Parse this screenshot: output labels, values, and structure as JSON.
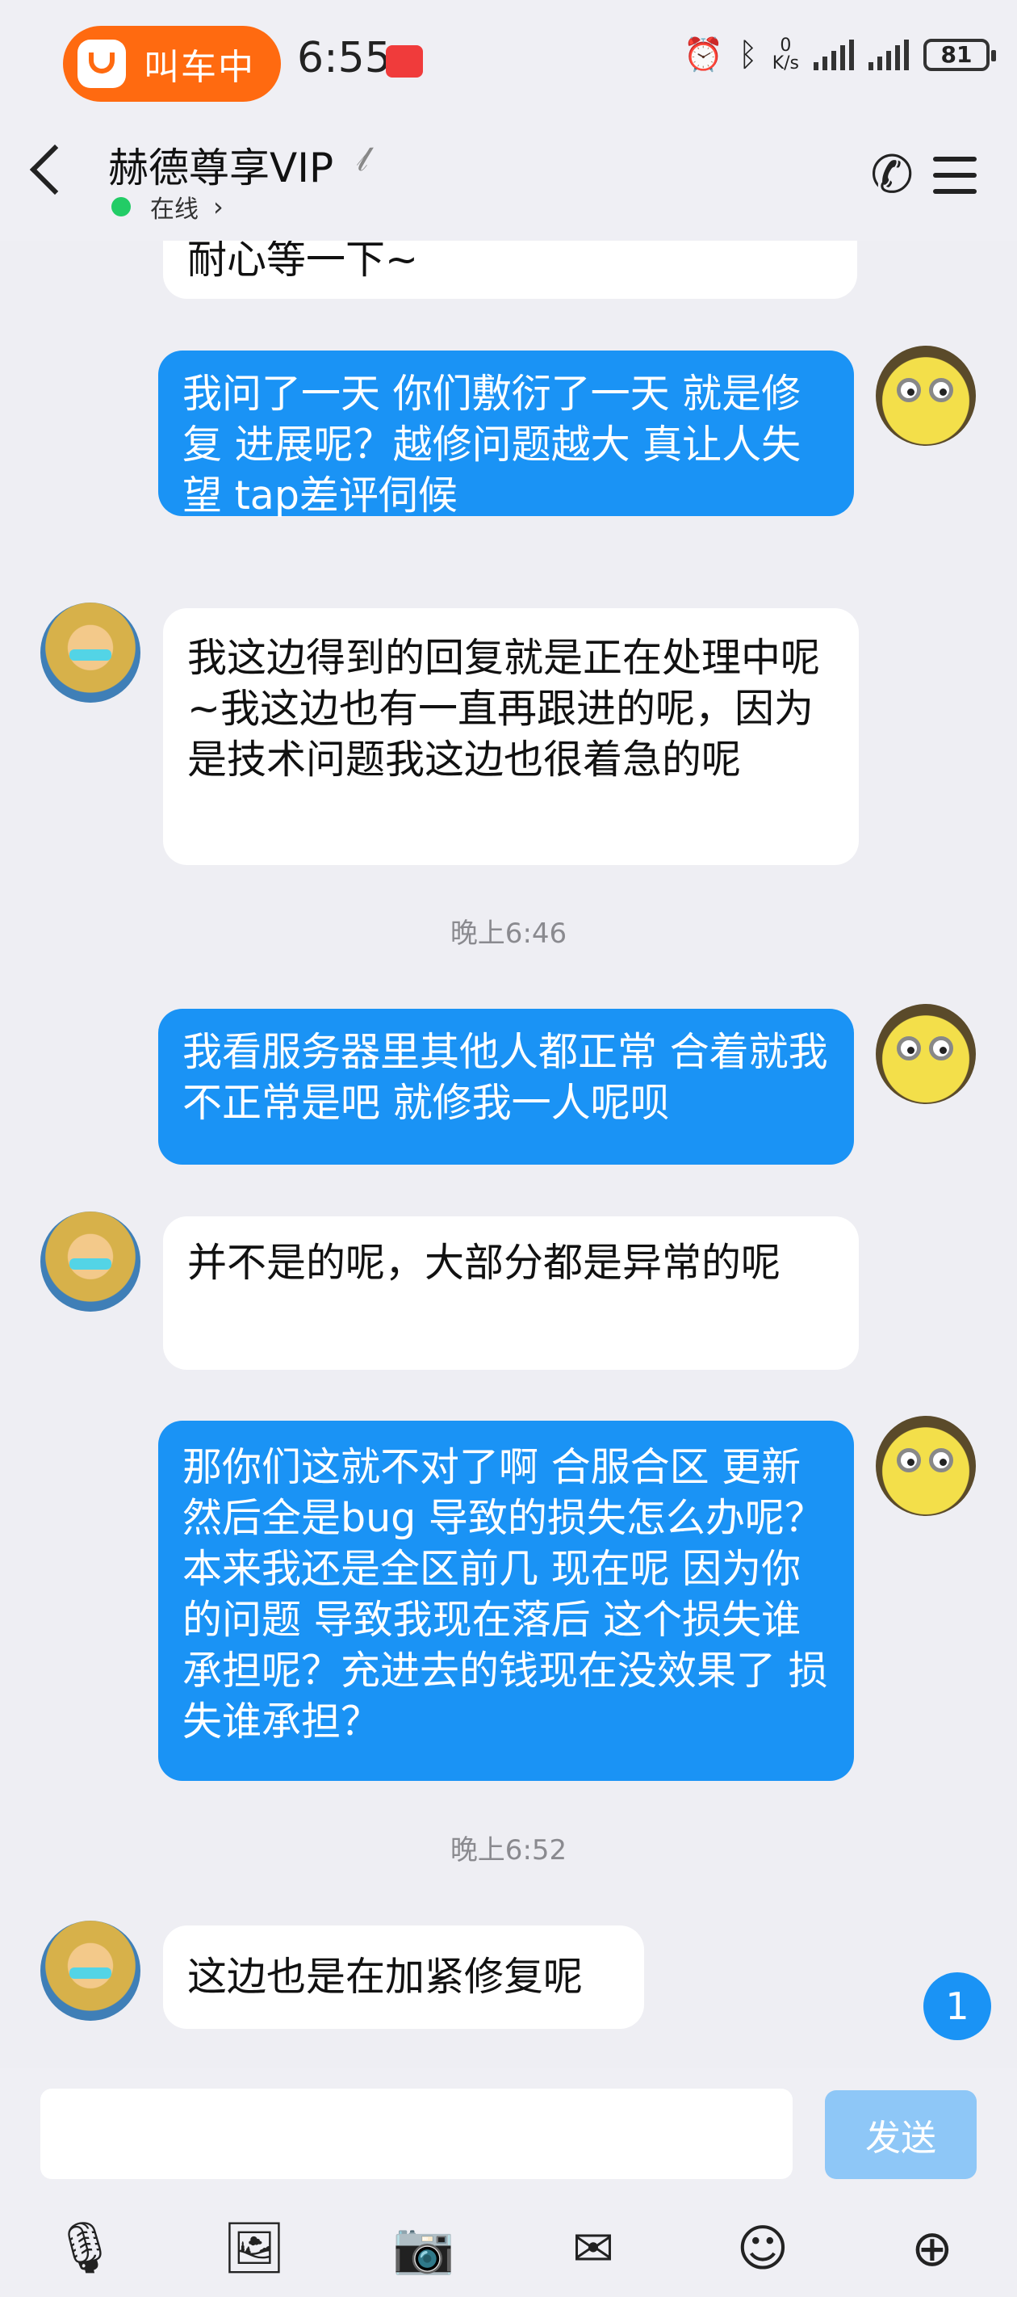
{
  "status_bar": {
    "ride_pill_label": "叫车中",
    "time": "6:55",
    "net_speed_value": "0",
    "net_speed_unit": "K/s",
    "battery": "81",
    "icons": [
      "alarm-icon",
      "bluetooth-icon",
      "signal-icon",
      "battery-icon"
    ]
  },
  "header": {
    "title": "赫德尊享VIP",
    "status": "在线",
    "icons": [
      "back-icon",
      "hearing-icon",
      "phone-icon",
      "menu-icon"
    ]
  },
  "messages": [
    {
      "side": "in",
      "text": "耐心等一下~"
    },
    {
      "side": "out",
      "text": "我问了一天 你们敷衍了一天 就是修复 进展呢？越修问题越大 真让人失望 tap差评伺候"
    },
    {
      "side": "in",
      "text": "我这边得到的回复就是正在处理中呢~我这边也有一直再跟进的呢，因为是技术问题我这边也很着急的呢"
    },
    {
      "type": "time",
      "text": "晚上6:46"
    },
    {
      "side": "out",
      "text": "我看服务器里其他人都正常 合着就我不正常是吧 就修我一人呢呗"
    },
    {
      "side": "in",
      "text": "并不是的呢，大部分都是异常的呢"
    },
    {
      "side": "out",
      "text": "那你们这就不对了啊 合服合区 更新 然后全是bug 导致的损失怎么办呢？本来我还是全区前几 现在呢 因为你的问题 导致我现在落后 这个损失谁承担呢？充进去的钱现在没效果了 损失谁承担？"
    },
    {
      "type": "time",
      "text": "晚上6:52"
    },
    {
      "side": "in",
      "text": "这边也是在加紧修复呢"
    }
  ],
  "unread_badge": "1",
  "composer": {
    "input_value": "",
    "send_label": "发送",
    "tools": [
      "microphone-icon",
      "image-icon",
      "camera-icon",
      "red-packet-icon",
      "emoji-icon",
      "plus-icon"
    ]
  },
  "colors": {
    "outgoing_bubble": "#1a93f5",
    "incoming_bubble": "#ffffff",
    "background": "#eeeef3",
    "ride_pill": "#ff6a10",
    "online_dot": "#22cc66"
  }
}
